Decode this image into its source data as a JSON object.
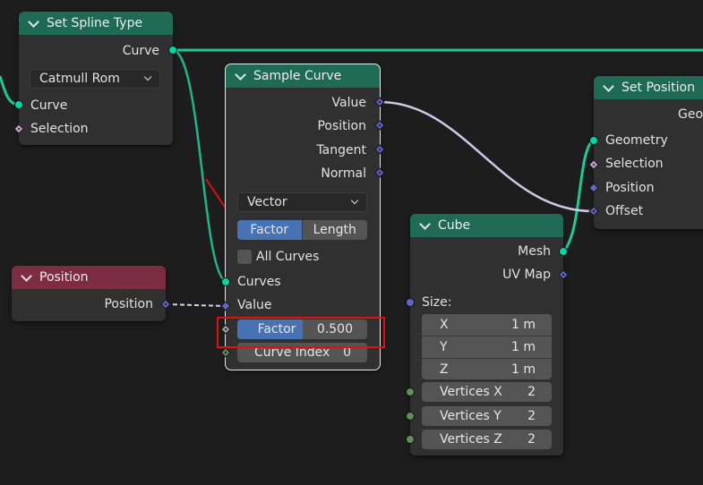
{
  "nodes": {
    "set_spline_type": {
      "title": "Set Spline Type",
      "out_curve": "Curve",
      "spline_type": "Catmull Rom",
      "in_curve": "Curve",
      "in_selection": "Selection"
    },
    "sample_curve": {
      "title": "Sample Curve",
      "out_value": "Value",
      "out_position": "Position",
      "out_tangent": "Tangent",
      "out_normal": "Normal",
      "data_type": "Vector",
      "mode_factor": "Factor",
      "mode_length": "Length",
      "all_curves": "All Curves",
      "in_curves": "Curves",
      "in_value": "Value",
      "factor_label": "Factor",
      "factor_value": "0.500",
      "factor_fraction": 0.5,
      "curve_index_label": "Curve Index",
      "curve_index_value": "0"
    },
    "position": {
      "title": "Position",
      "out_position": "Position"
    },
    "cube": {
      "title": "Cube",
      "out_mesh": "Mesh",
      "out_uvmap": "UV Map",
      "size_label": "Size:",
      "size_x_label": "X",
      "size_x": "1 m",
      "size_y_label": "Y",
      "size_y": "1 m",
      "size_z_label": "Z",
      "size_z": "1 m",
      "vx_label": "Vertices X",
      "vx": "2",
      "vy_label": "Vertices Y",
      "vy": "2",
      "vz_label": "Vertices Z",
      "vz": "2"
    },
    "set_position": {
      "title": "Set Position",
      "out_geometry": "Geom",
      "in_geometry": "Geometry",
      "in_selection": "Selection",
      "in_position": "Position",
      "in_offset": "Offset"
    }
  },
  "colors": {
    "geometry_socket": "#00d6a3",
    "vector_socket": "#6363c8",
    "integer_socket": "#5f8e5a",
    "boolean_socket": "#cca6d6",
    "float_socket": "#a1a1a1",
    "geometry_header": "#1e6a55",
    "input_header": "#7d2d43",
    "active_button": "#4772b3",
    "highlight_box": "#e01010",
    "annotation_arrow": "#e01010"
  }
}
